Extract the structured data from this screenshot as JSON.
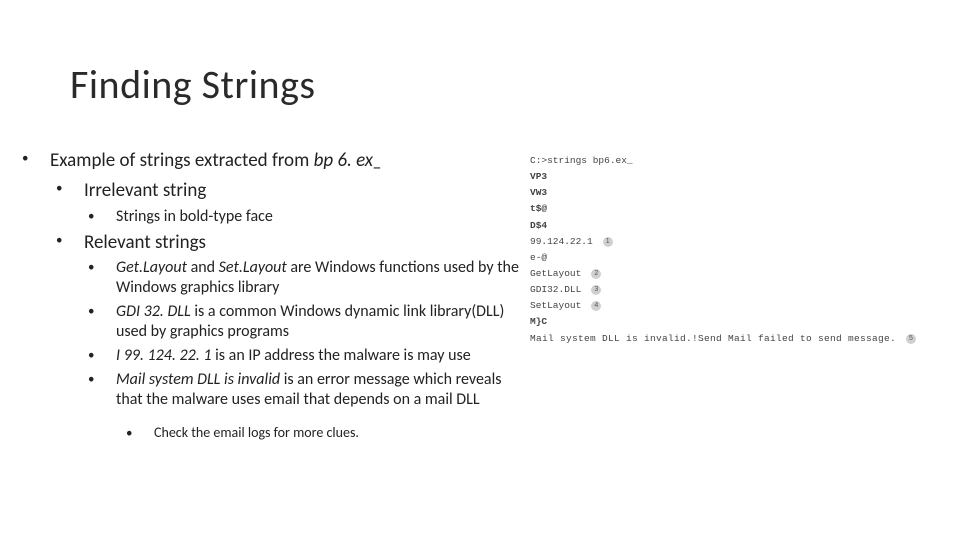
{
  "title": "Finding Strings",
  "b1": {
    "pre": "Example of strings extracted from ",
    "ital": "bp 6. ex_"
  },
  "b2": "Irrelevant string",
  "b2a": "Strings in bold-type face",
  "b3": "Relevant strings",
  "b3a": {
    "p1": "Get.Layout",
    "t1": " and ",
    "p2": "Set.Layout",
    "t2": " are Windows functions used by the Windows graphics library"
  },
  "b3b": {
    "p1": "GDI 32. DLL",
    "t1": " is a common Windows dynamic link library(DLL) used by graphics programs"
  },
  "b3c": {
    "p1": "I 99. 124. 22. 1",
    "t1": " is an IP address the malware is may use"
  },
  "b3d": {
    "p1": "Mail system DLL is invalid",
    "t1": " is an error message which reveals that the malware uses email that depends on a mail DLL"
  },
  "b4": "Check the email logs for more clues.",
  "code": {
    "cmd": "C:>strings bp6.ex_",
    "r1": "VP3",
    "r2": "VW3",
    "r3": "t$@",
    "r4": "D$4",
    "r5": "99.124.22.1",
    "r6": "e-@",
    "r7": "GetLayout",
    "r8": "GDI32.DLL",
    "r9": "SetLayout",
    "r10": "M}C",
    "r11": "Mail system DLL is invalid.!Send Mail failed to send message."
  },
  "marks": {
    "m1": "1",
    "m2": "2",
    "m3": "3",
    "m4": "4",
    "m5": "5"
  }
}
